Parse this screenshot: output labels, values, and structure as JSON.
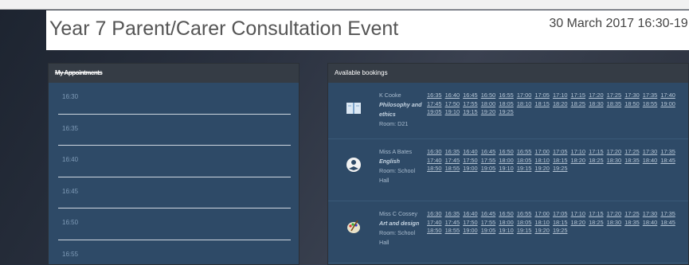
{
  "event": {
    "title": "Year 7 Parent/Carer Consultation Event",
    "date": "30 March 2017 16:30-19:3"
  },
  "schedule": {
    "title": "My Appointments",
    "slots": [
      "16:30",
      "16:35",
      "16:40",
      "16:45",
      "16:50",
      "16:55"
    ]
  },
  "bookings": {
    "title": "Available bookings",
    "teachers": [
      {
        "name": "K Cooke",
        "subject": "Philosophy and ethics",
        "room": "Room: D21",
        "icon": "book-icon",
        "slots": [
          "16:35",
          "16:40",
          "16:45",
          "16:50",
          "16:55",
          "17:00",
          "17:05",
          "17:10",
          "17:15",
          "17:20",
          "17:25",
          "17:30",
          "17:35",
          "17:40",
          "17:45",
          "17:50",
          "17:55",
          "18:00",
          "18:05",
          "18:10",
          "18:15",
          "18:20",
          "18:25",
          "18:30",
          "18:35",
          "18:50",
          "18:55",
          "19:00",
          "19:05",
          "19:10",
          "19:15",
          "19:20",
          "19:25"
        ]
      },
      {
        "name": "Miss A Bates",
        "subject": "English",
        "room": "Room: School Hall",
        "icon": "reading-icon",
        "slots": [
          "16:30",
          "16:35",
          "16:40",
          "16:45",
          "16:50",
          "16:55",
          "17:00",
          "17:05",
          "17:10",
          "17:15",
          "17:20",
          "17:25",
          "17:30",
          "17:35",
          "17:40",
          "17:45",
          "17:50",
          "17:55",
          "18:00",
          "18:05",
          "18:10",
          "18:15",
          "18:20",
          "18:25",
          "18:30",
          "18:35",
          "18:40",
          "18:45",
          "18:50",
          "18:55",
          "19:00",
          "19:05",
          "19:10",
          "19:15",
          "19:20",
          "19:25"
        ]
      },
      {
        "name": "Miss C Cossey",
        "subject": "Art and design",
        "room": "Room: School Hall",
        "icon": "palette-icon",
        "slots": [
          "16:30",
          "16:35",
          "16:40",
          "16:45",
          "16:50",
          "16:55",
          "17:00",
          "17:05",
          "17:10",
          "17:15",
          "17:20",
          "17:25",
          "17:30",
          "17:35",
          "17:40",
          "17:45",
          "17:50",
          "17:55",
          "18:00",
          "18:05",
          "18:10",
          "18:15",
          "18:20",
          "18:25",
          "18:30",
          "18:35",
          "18:40",
          "18:45",
          "18:50",
          "18:55",
          "19:00",
          "19:05",
          "19:10",
          "19:15",
          "19:20",
          "19:25"
        ]
      }
    ]
  },
  "colors": {
    "panel": "#2e4a67",
    "panel_header": "#353c45",
    "link": "#b6c6d6"
  }
}
